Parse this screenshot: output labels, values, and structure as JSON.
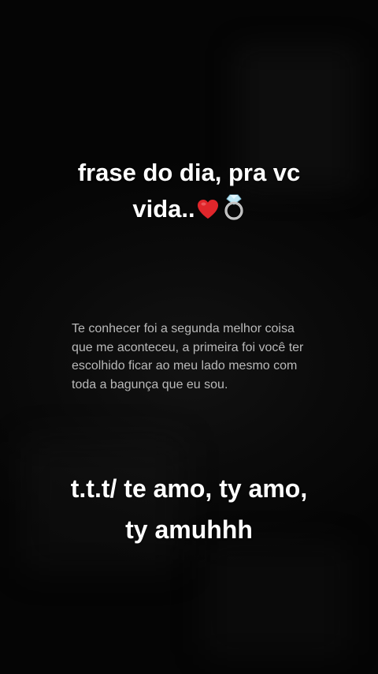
{
  "top_caption": {
    "line1": "frase do dia,  pra vc",
    "line2": "vida..",
    "heart_emoji": "❤️",
    "ring_emoji": "💍"
  },
  "quote": {
    "lines": [
      "Te conhecer foi a segunda melhor coisa",
      "que me aconteceu, a primeira foi você ter",
      "escolhido ficar ao meu lado mesmo com",
      "toda a bagunça que eu sou."
    ]
  },
  "bottom_caption": {
    "line1": "t.t.t/ te amo, ty amo,",
    "line2": "ty amuhhh"
  },
  "colors": {
    "background": "#050505",
    "caption_text": "#ffffff",
    "quote_text": "#b9b9b9",
    "heart": "#e0262b"
  }
}
